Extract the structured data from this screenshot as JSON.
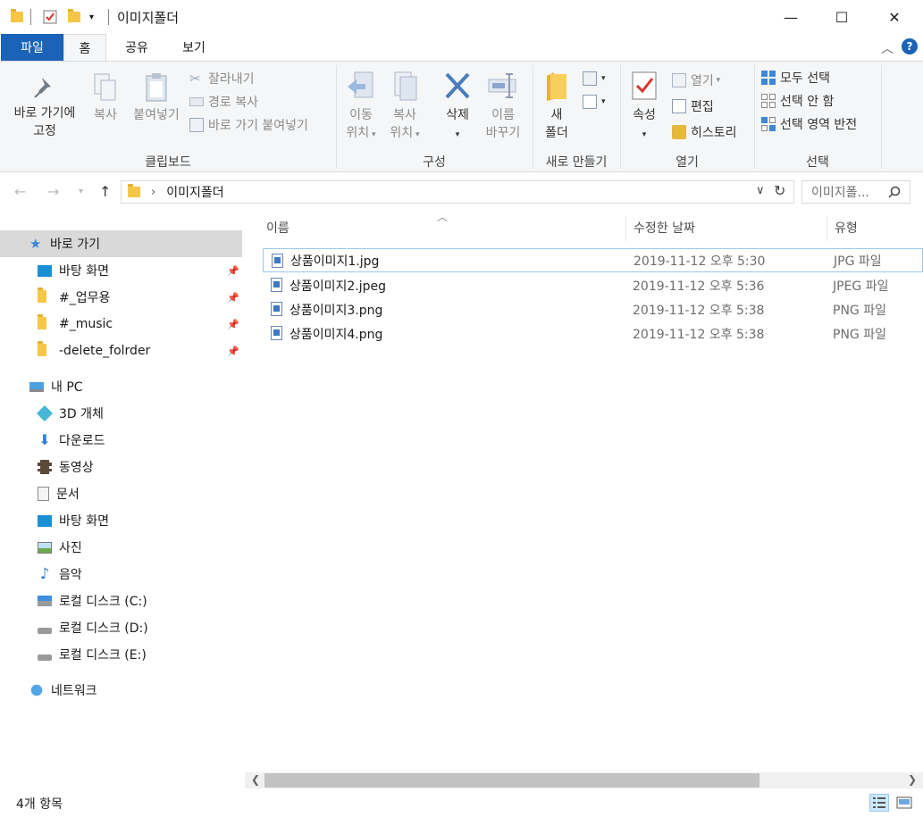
{
  "window": {
    "title": "이미지폴더",
    "controls": {
      "minimize": "—",
      "maximize": "☐",
      "close": "✕"
    }
  },
  "ribbon_tabs": {
    "file": "파일",
    "home": "홈",
    "share": "공유",
    "view": "보기"
  },
  "ribbon": {
    "clipboard": {
      "label": "클립보드",
      "pin_line1": "바로 가기에",
      "pin_line2": "고정",
      "copy": "복사",
      "paste": "붙여넣기",
      "cut": "잘라내기",
      "copy_path": "경로 복사",
      "paste_shortcut": "바로 가기 붙여넣기"
    },
    "organize": {
      "label": "구성",
      "move_line1": "이동",
      "move_line2": "위치",
      "copyto_line1": "복사",
      "copyto_line2": "위치",
      "delete": "삭제",
      "rename_line1": "이름",
      "rename_line2": "바꾸기"
    },
    "new": {
      "label": "새로 만들기",
      "folder_line1": "새",
      "folder_line2": "폴더"
    },
    "open": {
      "label": "열기",
      "properties": "속성",
      "open": "열기",
      "edit": "편집",
      "history": "히스토리"
    },
    "select": {
      "label": "선택",
      "select_all": "모두 선택",
      "select_none": "선택 안 함",
      "invert": "선택 영역 반전"
    }
  },
  "address": {
    "path": "이미지폴더",
    "search_placeholder": "이미지폴..."
  },
  "nav_pane": {
    "quick_access": "바로 가기",
    "pinned": [
      "바탕 화면",
      "#_업무용",
      "#_music",
      "-delete_folrder"
    ],
    "this_pc": "내 PC",
    "pc_items": [
      "3D 개체",
      "다운로드",
      "동영상",
      "문서",
      "바탕 화면",
      "사진",
      "음악",
      "로컬 디스크 (C:)",
      "로컬 디스크 (D:)",
      "로컬 디스크 (E:)"
    ],
    "network": "네트워크"
  },
  "file_list": {
    "columns": {
      "name": "이름",
      "date": "수정한 날짜",
      "type": "유형"
    },
    "rows": [
      {
        "name": "상품이미지1.jpg",
        "date": "2019-11-12 오후 5:30",
        "type": "JPG 파일"
      },
      {
        "name": "상품이미지2.jpeg",
        "date": "2019-11-12 오후 5:36",
        "type": "JPEG 파일"
      },
      {
        "name": "상품이미지3.png",
        "date": "2019-11-12 오후 5:38",
        "type": "PNG 파일"
      },
      {
        "name": "상품이미지4.png",
        "date": "2019-11-12 오후 5:38",
        "type": "PNG 파일"
      }
    ]
  },
  "status": {
    "item_count": "4개 항목"
  },
  "colors": {
    "accent": "#1a63b8",
    "selection": "#cce8ff",
    "folder": "#f6c647"
  }
}
